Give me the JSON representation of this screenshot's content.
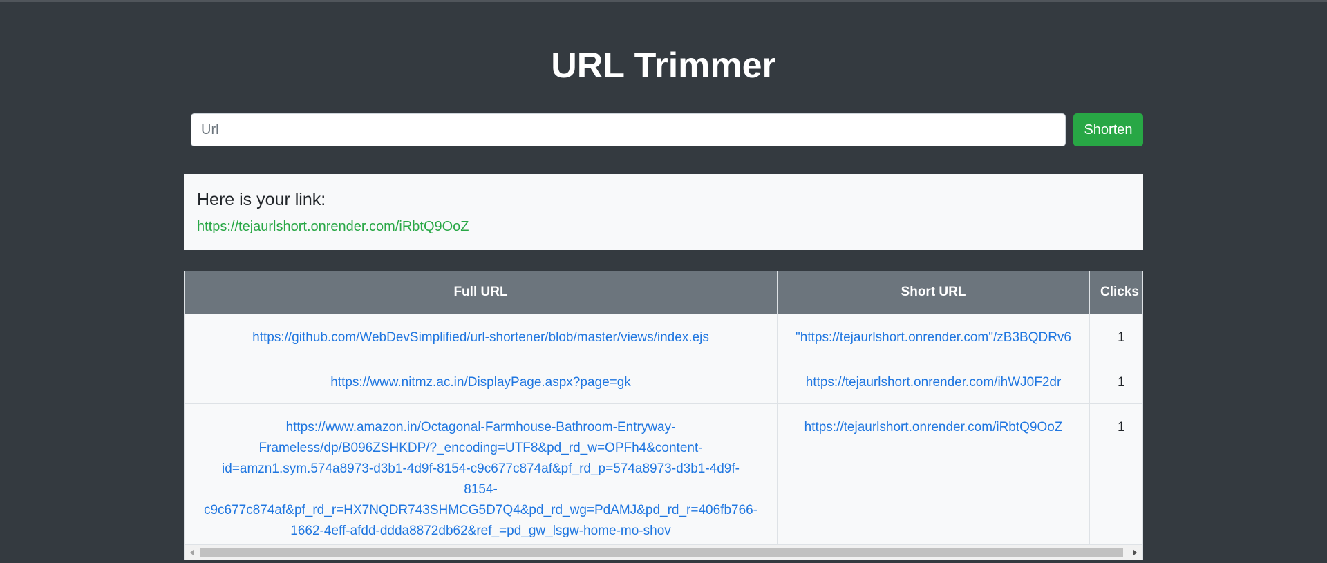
{
  "app": {
    "title": "URL Trimmer"
  },
  "form": {
    "input_placeholder": "Url",
    "input_value": "",
    "submit_label": "Shorten"
  },
  "result": {
    "heading": "Here is your link:",
    "link": "https://tejaurlshort.onrender.com/iRbtQ9OoZ"
  },
  "table": {
    "headers": {
      "full": "Full URL",
      "short": "Short URL",
      "clicks": "Clicks"
    },
    "rows": [
      {
        "full": "https://github.com/WebDevSimplified/url-shortener/blob/master/views/index.ejs",
        "short": "\"https://tejaurlshort.onrender.com\"/zB3BQDRv6",
        "clicks": "1"
      },
      {
        "full": "https://www.nitmz.ac.in/DisplayPage.aspx?page=gk",
        "short": "https://tejaurlshort.onrender.com/ihWJ0F2dr",
        "clicks": "1"
      },
      {
        "full": "https://www.amazon.in/Octagonal-Farmhouse-Bathroom-Entryway-Frameless/dp/B096ZSHKDP/?_encoding=UTF8&pd_rd_w=OPFh4&content-id=amzn1.sym.574a8973-d3b1-4d9f-8154-c9c677c874af&pf_rd_p=574a8973-d3b1-4d9f-8154-c9c677c874af&pf_rd_r=HX7NQDR743SHMCG5D7Q4&pd_rd_wg=PdAMJ&pd_rd_r=406fb766-1662-4eff-afdd-ddda8872db62&ref_=pd_gw_lsgw-home-mo-shov",
        "full_lines": [
          "https://www.amazon.in/Octagonal-Farmhouse-Bathroom-Entryway-",
          "Frameless/dp/B096ZSHKDP/?_encoding=UTF8&pd_rd_w=OPFh4&content-",
          "id=amzn1.sym.574a8973-d3b1-4d9f-8154-c9c677c874af&pf_rd_p=574a8973-d3b1-4d9f-",
          "8154-",
          "c9c677c874af&pf_rd_r=HX7NQDR743SHMCG5D7Q4&pd_rd_wg=PdAMJ&pd_rd_r=406fb766-",
          "1662-4eff-afdd-ddda8872db62&ref_=pd_gw_lsgw-home-mo-shov"
        ],
        "short": "https://tejaurlshort.onrender.com/iRbtQ9OoZ",
        "clicks": "1"
      }
    ]
  },
  "colors": {
    "background": "#343a40",
    "accent": "#28a745",
    "link": "#1f76e0",
    "table_header": "#6c757d",
    "panel": "#f8f9fa"
  }
}
